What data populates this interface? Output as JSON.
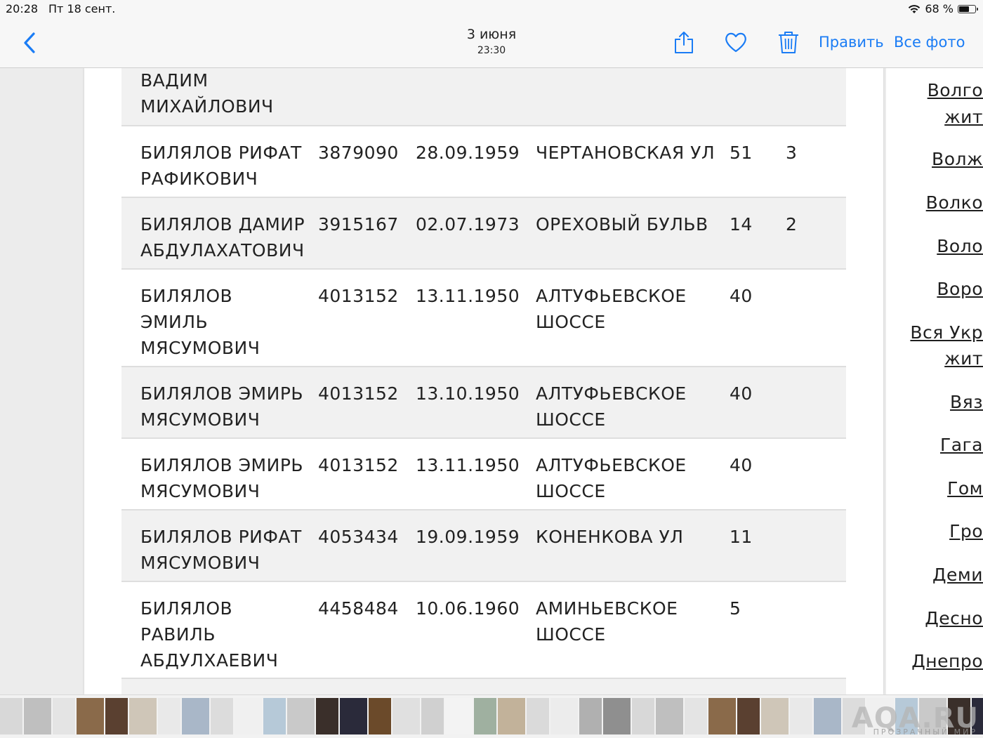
{
  "status_bar": {
    "time": "20:28",
    "date": "Пт 18 сент.",
    "battery_text": "68 %",
    "battery_level": 0.68,
    "icons": [
      "wifi-icon",
      "battery-icon"
    ]
  },
  "nav": {
    "date": "3 июня",
    "time": "23:30",
    "edit_label": "Править",
    "all_photos_label": "Все фото",
    "icons": [
      "back-chevron-icon",
      "share-icon",
      "heart-icon",
      "trash-icon"
    ],
    "accent_color": "#1a7cf5"
  },
  "table": {
    "top_fragment": "ВАДИМ\nМИХАЙЛОВИЧ",
    "rows": [
      {
        "name": "БИЛЯЛОВ РИФАТ РАФИКОВИЧ",
        "num": "3879090",
        "date": "28.09.1959",
        "street": "ЧЕРТАНОВСКАЯ УЛ",
        "house": "51",
        "flat": "3"
      },
      {
        "name": "БИЛЯЛОВ ДАМИР АБДУЛАХАТОВИЧ",
        "num": "3915167",
        "date": "02.07.1973",
        "street": "ОРЕХОВЫЙ БУЛЬВ",
        "house": "14",
        "flat": "2"
      },
      {
        "name": "БИЛЯЛОВ ЭМИЛЬ МЯСУМОВИЧ",
        "num": "4013152",
        "date": "13.11.1950",
        "street": "АЛТУФЬЕВСКОЕ ШОССЕ",
        "house": "40",
        "flat": ""
      },
      {
        "name": "БИЛЯЛОВ ЭМИРЬ МЯСУМОВИЧ",
        "num": "4013152",
        "date": "13.10.1950",
        "street": "АЛТУФЬЕВСКОЕ ШОССЕ",
        "house": "40",
        "flat": ""
      },
      {
        "name": "БИЛЯЛОВ ЭМИРЬ МЯСУМОВИЧ",
        "num": "4013152",
        "date": "13.11.1950",
        "street": "АЛТУФЬЕВСКОЕ ШОССЕ",
        "house": "40",
        "flat": ""
      },
      {
        "name": "БИЛЯЛОВ РИФАТ МЯСУМОВИЧ",
        "num": "4053434",
        "date": "19.09.1959",
        "street": "КОНЕНКОВА УЛ",
        "house": "11",
        "flat": ""
      },
      {
        "name": "БИЛЯЛОВ РАВИЛЬ АБДУЛХАЕВИЧ",
        "num": "4458484",
        "date": "10.06.1960",
        "street": "АМИНЬЕВСКОЕ ШОССЕ",
        "house": "5",
        "flat": ""
      }
    ]
  },
  "sidebar_links": [
    "Волго",
    "жит",
    "Волж",
    "Волко",
    "Воло",
    "Воро",
    "Вся Укр",
    "жит",
    "Вяз",
    "Гага",
    "Гом",
    "Гро",
    "Деми",
    "Десно",
    "Днепро"
  ],
  "watermark": {
    "text": "AQA.RU",
    "sub": "ПРОЗРАЧНЫЙ МИР"
  }
}
